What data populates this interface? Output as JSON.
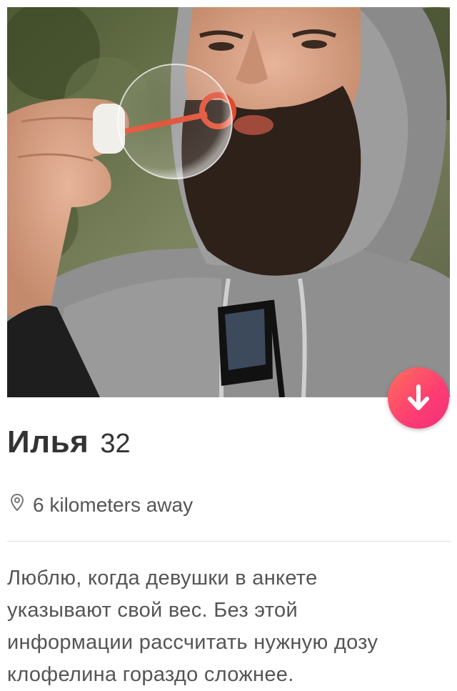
{
  "profile": {
    "photo_description": "",
    "name": "Илья",
    "age": "32",
    "distance": "6 kilometers away",
    "bio_lines": [
      "Люблю, когда девушки в анкете",
      "указывают свой вес. Без этой",
      "информации рассчитать нужную дозу",
      "клофелина гораздо сложнее."
    ]
  },
  "icons": {
    "collapse": "arrow-down-icon",
    "location": "location-pin-icon"
  },
  "colors": {
    "accent_start": "#ff6f5c",
    "accent_end": "#fe3c72",
    "text_primary": "#333333",
    "text_secondary": "#555555"
  }
}
